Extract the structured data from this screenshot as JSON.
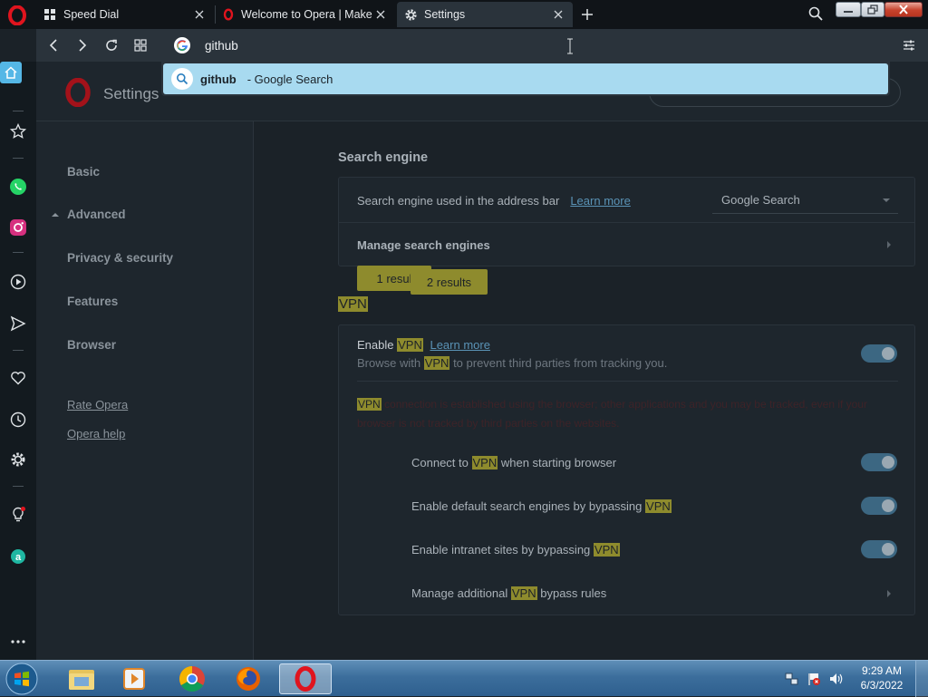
{
  "tabs": [
    {
      "title": "Speed Dial",
      "icon": "speed-dial-icon"
    },
    {
      "title": "Welcome to Opera | Make",
      "icon": "opera-icon"
    },
    {
      "title": "Settings",
      "icon": "gear-icon"
    }
  ],
  "address_bar": {
    "value": "github"
  },
  "suggestion": {
    "query": "github",
    "suffix": "- Google Search"
  },
  "settings_header": {
    "title": "Settings"
  },
  "nav": {
    "basic": "Basic",
    "advanced": "Advanced",
    "privacy": "Privacy & security",
    "features": "Features",
    "browser": "Browser",
    "rate": "Rate Opera",
    "help": "Opera help"
  },
  "search_engine": {
    "heading": "Search engine",
    "label": "Search engine used in the address bar",
    "learn_more": "Learn more",
    "selected": "Google Search",
    "manage": "Manage search engines",
    "bubble1": "1 resul",
    "bubble2": "2 results"
  },
  "vpn": {
    "heading": "VPN",
    "enable_prefix": "Enable",
    "word": "VPN",
    "learn_more": "Learn more",
    "desc_prefix": "Browse with",
    "desc_suffix": "to prevent third parties from tracking you.",
    "warning_rest": "connection is established using the browser; other applications and you may be tracked, even if your browser is not tracked by third parties on the",
    "warning_line2": "websites.",
    "connect_prefix": "Connect to",
    "connect_suffix": "when starting browser",
    "default_prefix": "Enable default search engines by bypassing",
    "intranet_prefix": "Enable intranet sites by bypassing",
    "manage_prefix": "Manage additional",
    "manage_suffix": "bypass rules",
    "enable_on": true,
    "connect_on": true,
    "default_on": true,
    "intranet_on": true
  },
  "clock": {
    "time": "9:29 AM",
    "date": "6/3/2022"
  },
  "colors": {
    "accent": "#3c6782",
    "highlight": "#8e8b2d",
    "opera_red": "#e0141e",
    "suggestion": "#a8daf0"
  }
}
